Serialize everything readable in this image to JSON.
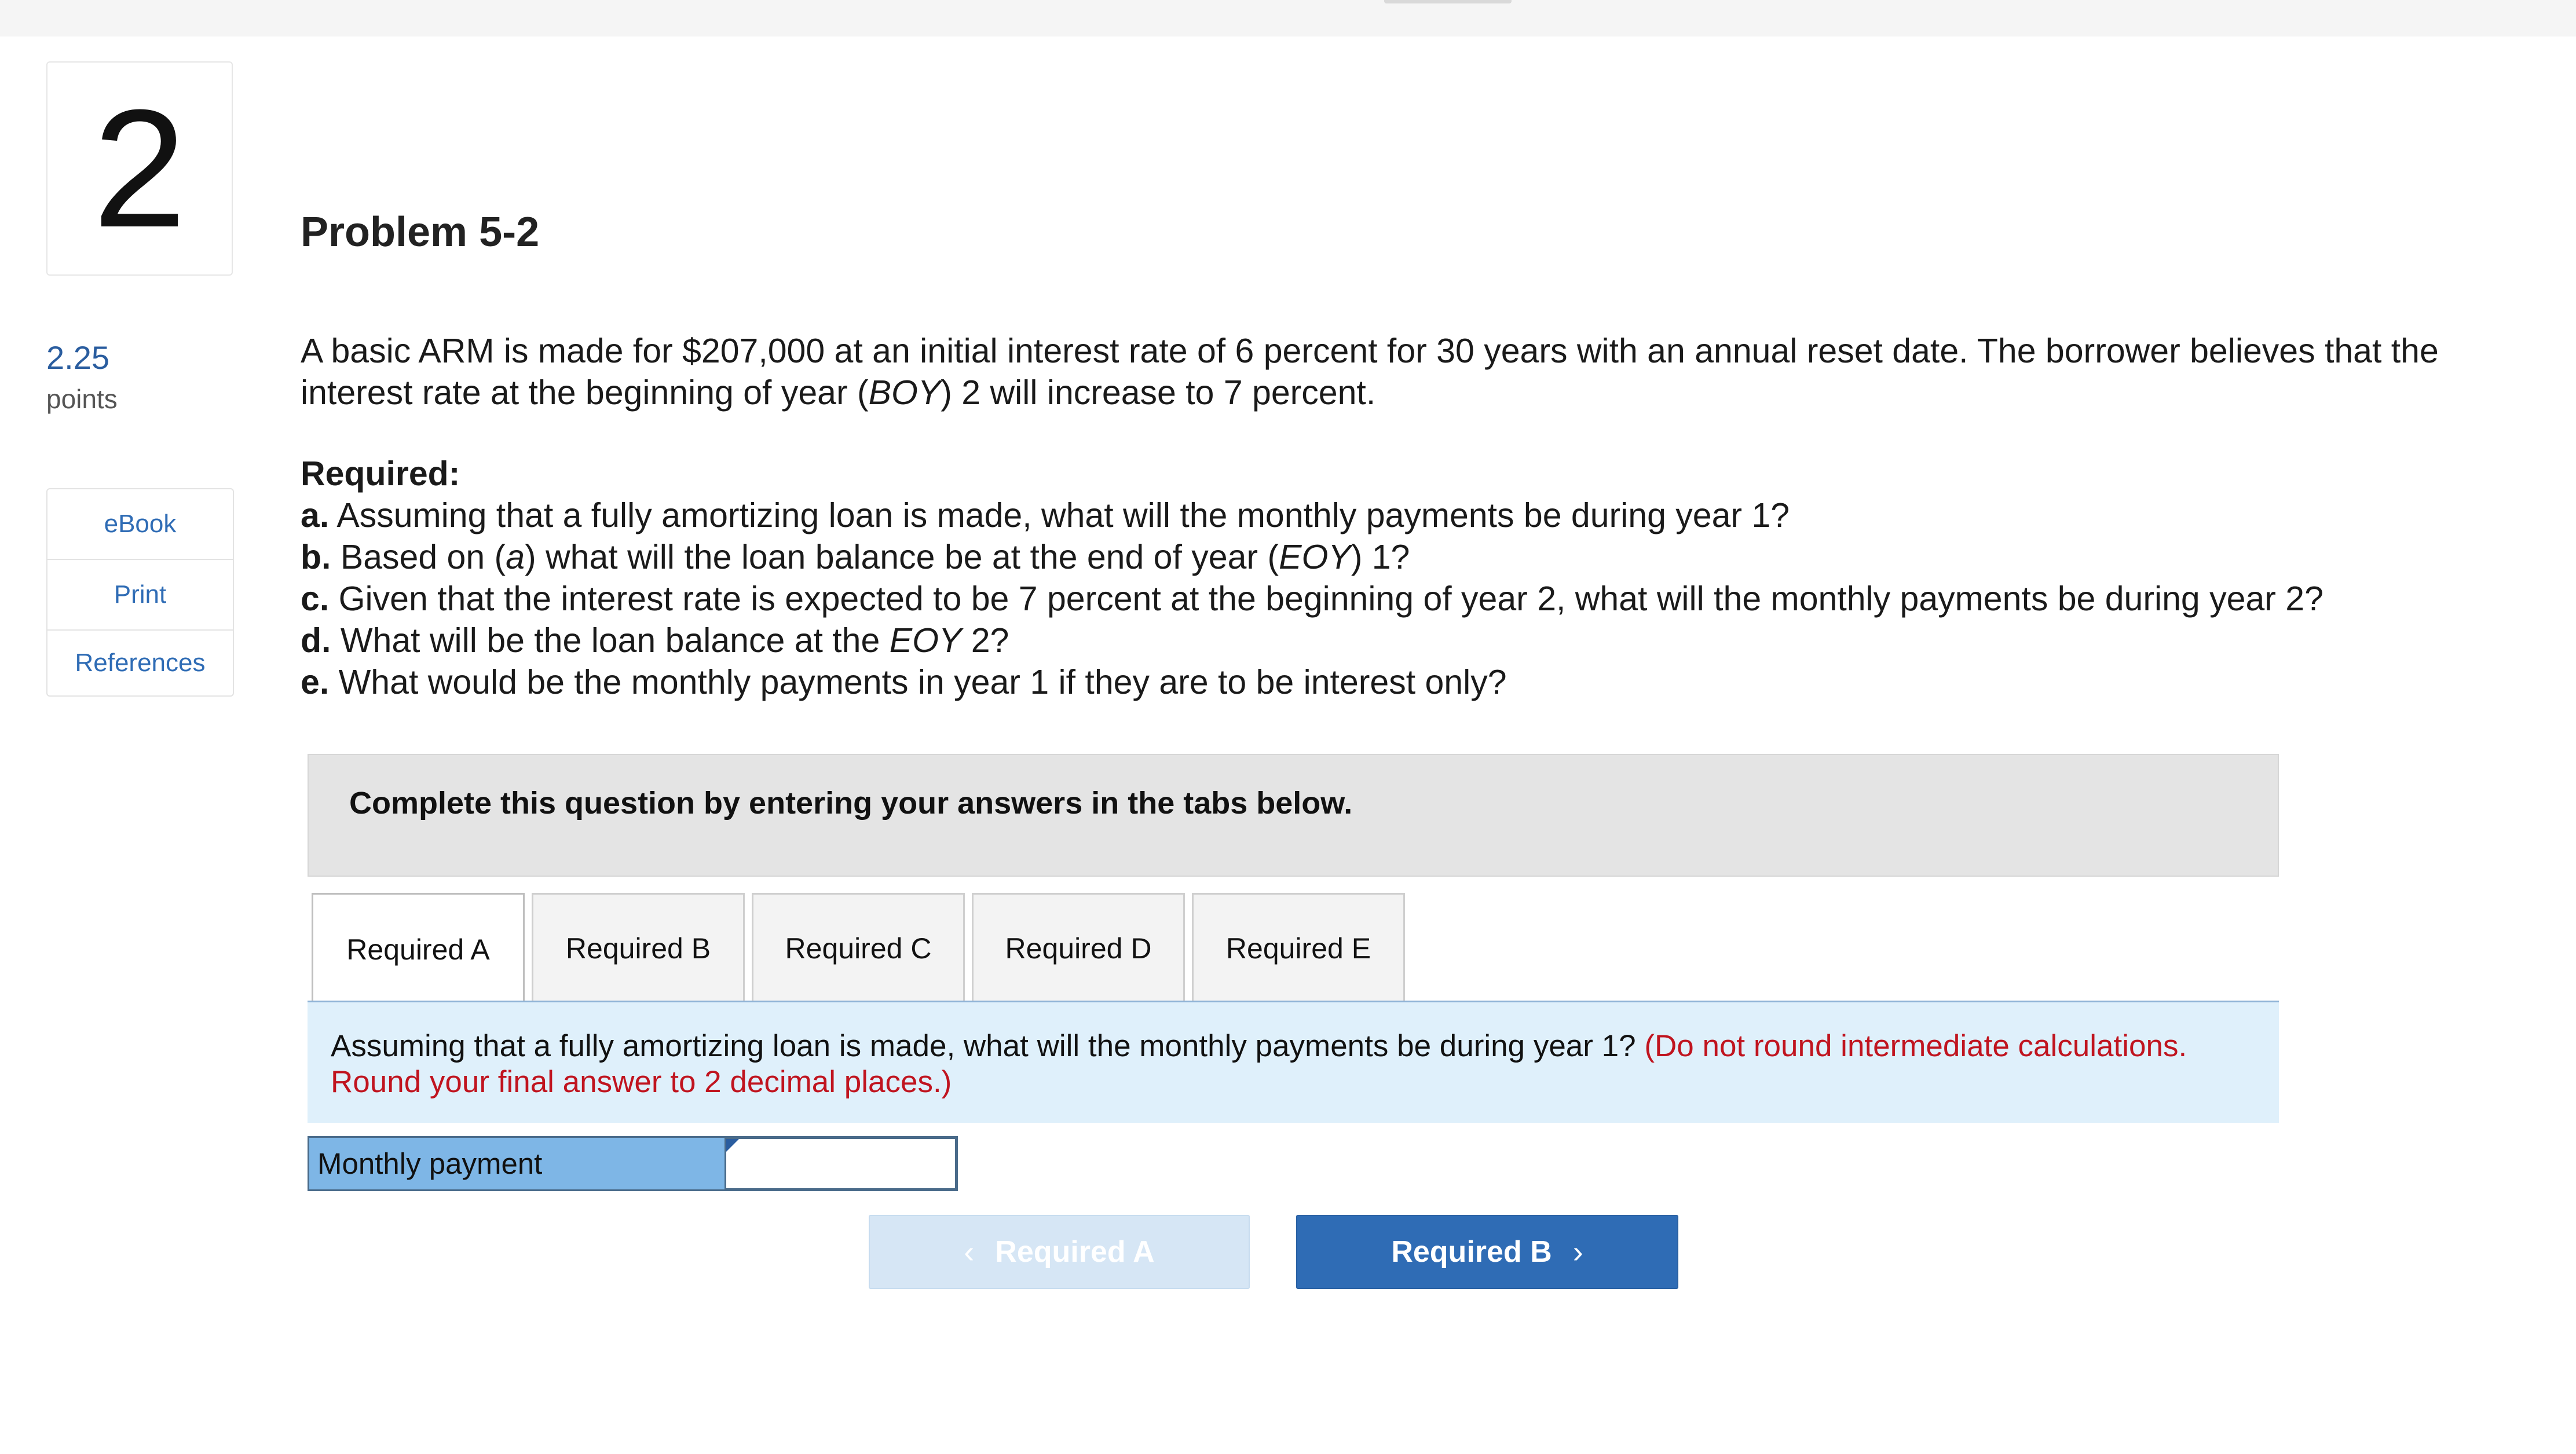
{
  "question": {
    "number": "2",
    "points_value": "2.25",
    "points_label": "points"
  },
  "side_links": [
    "eBook",
    "Print",
    "References"
  ],
  "problem": {
    "title": "Problem 5-2",
    "prompt_part1": "A basic ARM is made for $207,000 at an initial interest rate of 6 percent for 30 years with an annual reset date. The borrower believes that the interest rate at the beginning of year (",
    "prompt_boy": "BOY",
    "prompt_part2": ") 2 will increase to 7 percent."
  },
  "required": {
    "heading": "Required:",
    "a": {
      "letter": "a.",
      "text": "Assuming that a fully amortizing loan is made, what will the monthly payments be during year 1?"
    },
    "b": {
      "letter": "b.",
      "pre": "Based on (",
      "ital": "a",
      "mid": ") what will the loan balance be at the end of year (",
      "ital2": "EOY",
      "post": ") 1?"
    },
    "c": {
      "letter": "c.",
      "text": "Given that the interest rate is expected to be 7 percent at the beginning of year 2, what will the monthly payments be during year 2?"
    },
    "d": {
      "letter": "d.",
      "pre": "What will be the loan balance at the ",
      "ital": "EOY",
      "post": " 2?"
    },
    "e": {
      "letter": "e.",
      "text": "What would be the monthly payments in year 1 if they are to be interest only?"
    }
  },
  "instructions": "Complete this question by entering your answers in the tabs below.",
  "tabs": [
    {
      "label": "Required A",
      "active": true
    },
    {
      "label": "Required B",
      "active": false
    },
    {
      "label": "Required C",
      "active": false
    },
    {
      "label": "Required D",
      "active": false
    },
    {
      "label": "Required E",
      "active": false
    }
  ],
  "panel": {
    "question": "Assuming that a fully amortizing loan is made, what will the monthly payments be during year 1?",
    "note": "(Do not round intermediate calculations. Round your final answer to 2 decimal places.)"
  },
  "answer": {
    "label": "Monthly payment",
    "value": ""
  },
  "nav": {
    "prev_label": "Required A",
    "next_label": "Required B",
    "prev_icon": "chevron-left-icon",
    "next_icon": "chevron-right-icon"
  },
  "colors": {
    "accent": "#2f6cb5",
    "note_red": "#c0141f",
    "panel_bg": "#dff0fb",
    "label_bg": "#7eb6e6"
  }
}
